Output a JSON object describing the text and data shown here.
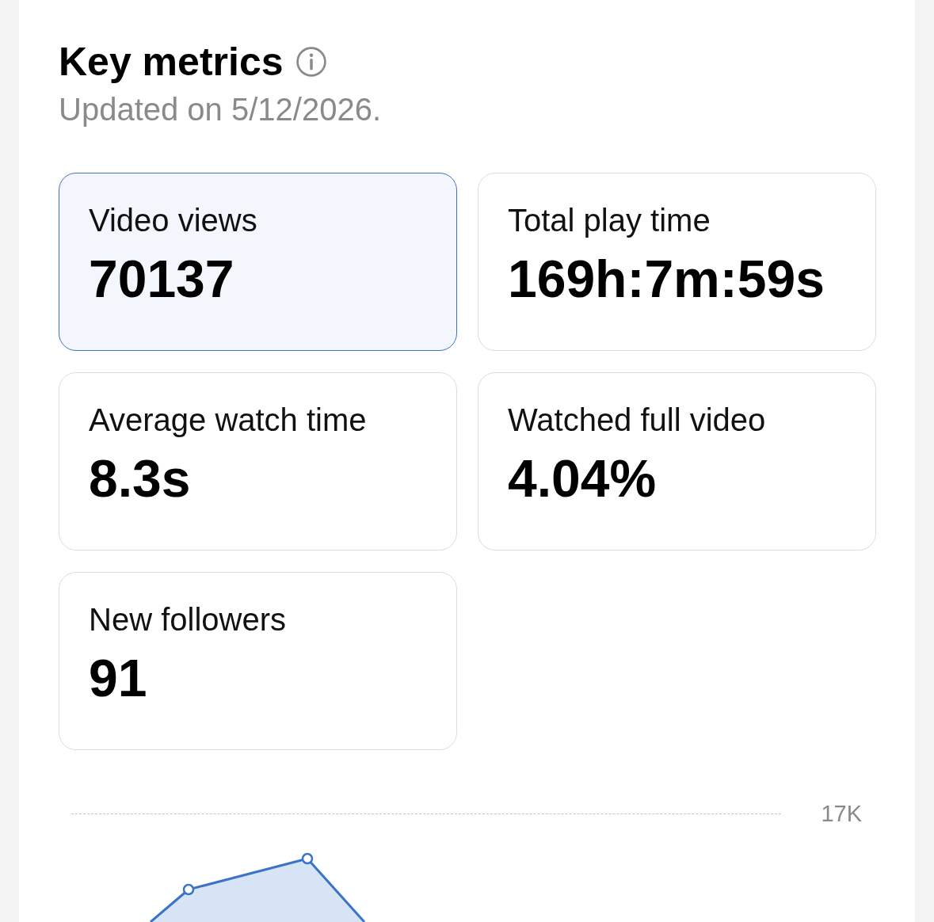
{
  "header": {
    "title": "Key metrics",
    "subtitle": "Updated on 5/12/2026."
  },
  "metrics": [
    {
      "label": "Video views",
      "value": "70137",
      "selected": true
    },
    {
      "label": "Total play time",
      "value": "169h:7m:59s",
      "selected": false
    },
    {
      "label": "Average watch time",
      "value": "8.3s",
      "selected": false
    },
    {
      "label": "Watched full video",
      "value": "4.04%",
      "selected": false
    },
    {
      "label": "New followers",
      "value": "91",
      "selected": false
    }
  ],
  "chart": {
    "y_tick_label": "17K"
  }
}
